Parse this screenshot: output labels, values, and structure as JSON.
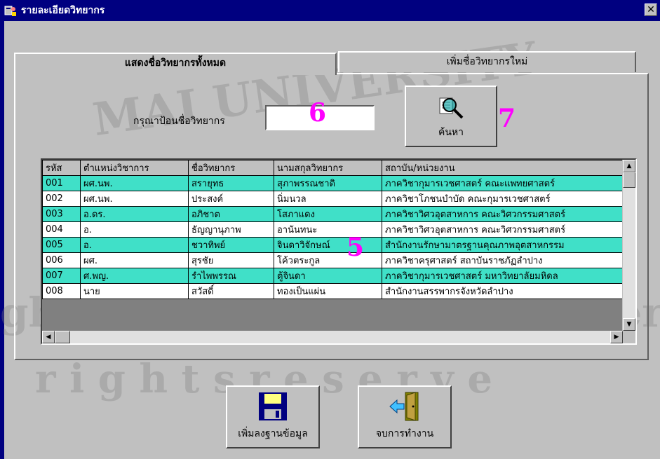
{
  "window": {
    "title": "รายละเอียดวิทยากร",
    "close_glyph": "✕"
  },
  "tabs": [
    {
      "label": "แสดงชื่อวิทยากรทั้งหมด",
      "active": true
    },
    {
      "label": "เพิ่มชื่อวิทยากรใหม่",
      "active": false
    }
  ],
  "search": {
    "prompt": "กรุณาป้อนชื่อวิทยากร",
    "value": "",
    "button_label": "ค้นหา"
  },
  "annotations": {
    "grid": "5",
    "input": "6",
    "button": "7"
  },
  "table": {
    "columns": [
      "รหัส",
      "ตำแหน่งวิชาการ",
      "ชื่อวิทยากร",
      "นามสกุลวิทยากร",
      "สถาบัน/หน่วยงาน"
    ],
    "rows": [
      [
        "001",
        "ผศ.นพ.",
        "สรายุทธ",
        "สุภาพรรณชาติ",
        "ภาควิชากุมารเวชศาสตร์ คณะแพทยศาสตร์"
      ],
      [
        "002",
        "ผศ.นพ.",
        "ประสงค์",
        "นิ่มนวล",
        "ภาควิชาโภชนบำบัด คณะกุมารเวชศาสตร์"
      ],
      [
        "003",
        "อ.ดร.",
        "อภิชาต",
        "โสภาแดง",
        "ภาควิชาวิศวอุตสาหการ คณะวิศวกรรมศาสตร์"
      ],
      [
        "004",
        "อ.",
        "ธัญญานุภาพ",
        "อานันทนะ",
        "ภาควิชาวิศวอุตสาหการ คณะวิศวกรรมศาสตร์"
      ],
      [
        "005",
        "อ.",
        "ชวาทิพย์",
        "จินดาวิจักษณ์",
        "สำนักงานรักษามาตรฐานคุณภาพอุตสาหกรรม"
      ],
      [
        "006",
        "ผศ.",
        "สุรชัย",
        "โค้วตระกูล",
        "ภาควิชาครุศาสตร์ สถาบันราชภัฏลำปาง"
      ],
      [
        "007",
        "ศ.พญ.",
        "รำไพพรรณ",
        "ตู้จินดา",
        "ภาควิชากุมารเวชศาสตร์ มหาวิทยาลัยมหิดล"
      ],
      [
        "008",
        "นาย",
        "สวัสดิ์",
        "ทองเป็นแผ่น",
        "สำนักงานสรรพากรจังหวัดลำปาง"
      ]
    ]
  },
  "buttons": {
    "save_label": "เพิ่มลงฐานข้อมูล",
    "exit_label": "จบการทำงาน"
  },
  "watermark": {
    "line1": "MAI UNIVERSITY",
    "line2": "ghts © by Chiang Mai Univers",
    "line3": "r i g h t s   r e s e r v e"
  },
  "colors": {
    "titlebar": "#000080",
    "row_highlight": "#40e0c8",
    "annotation": "#ff00ff",
    "window": "#c0c0c0"
  }
}
